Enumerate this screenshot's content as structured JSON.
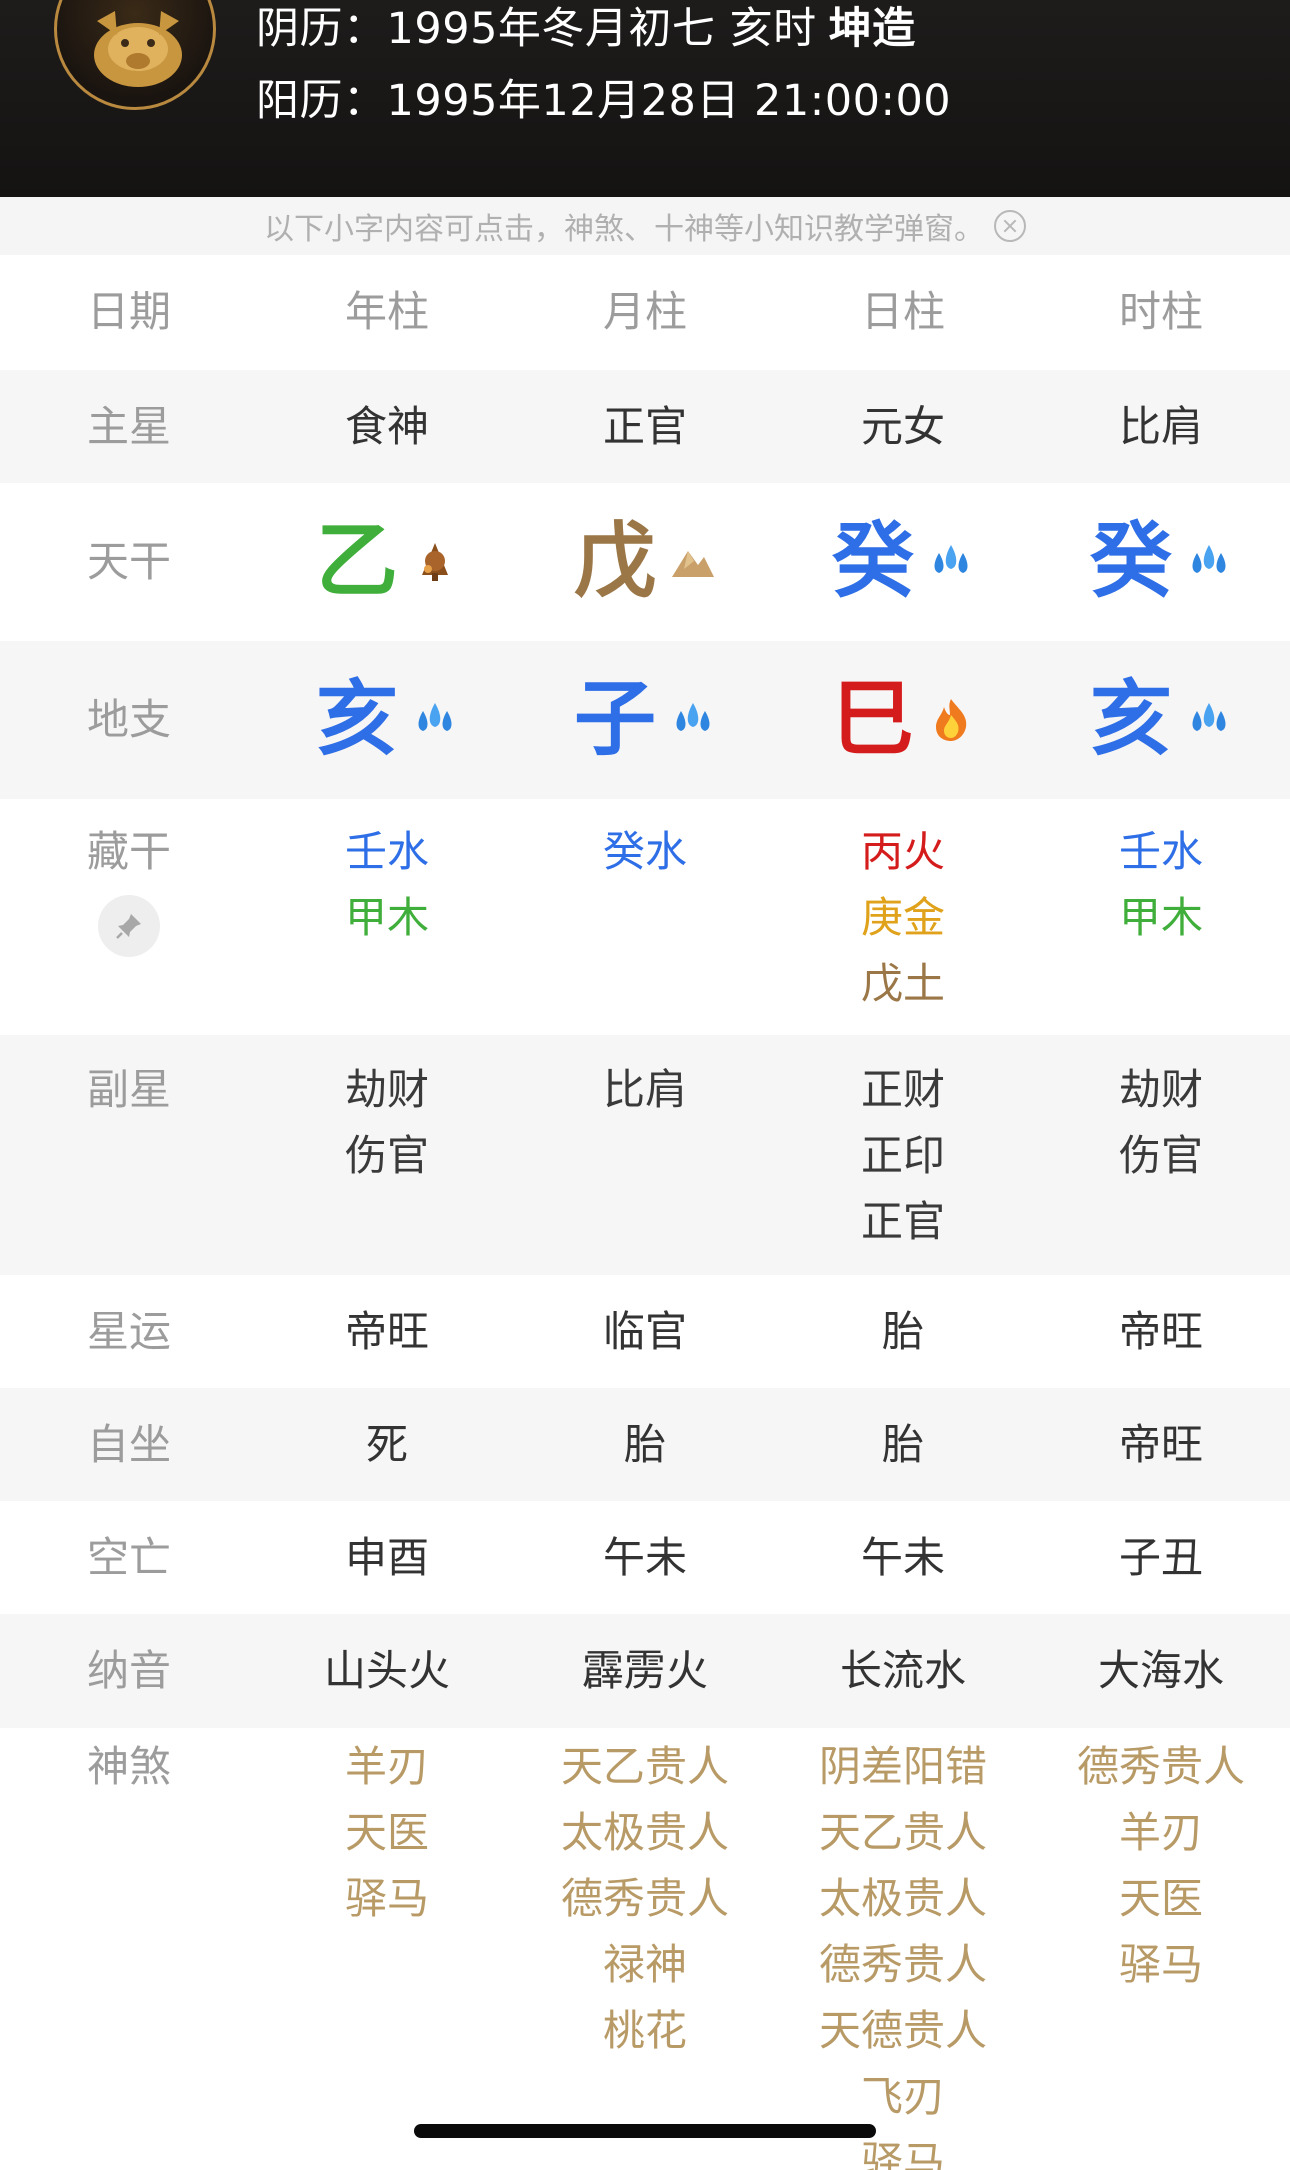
{
  "header": {
    "lunar": "阴历：1995年冬月初七 亥时",
    "gender_tag": "坤造",
    "solar": "阳历：1995年12月28日 21:00:00"
  },
  "notice": "以下小字内容可点击，神煞、十神等小知识教学弹窗。",
  "columns": [
    "日期",
    "年柱",
    "月柱",
    "日柱",
    "时柱"
  ],
  "labels": {
    "main_star": "主星",
    "heavenly_stem": "天干",
    "earthly_branch": "地支",
    "hidden_stem": "藏干",
    "sub_star": "副星",
    "star_luck": "星运",
    "self_seat": "自坐",
    "kongwang": "空亡",
    "nayin": "纳音",
    "shensha": "神煞"
  },
  "main_star": [
    "食神",
    "正官",
    "元女",
    "比肩"
  ],
  "heavenly_stem": [
    {
      "char": "乙",
      "color": "#3fae3a",
      "element_icon": "wood-element-icon"
    },
    {
      "char": "戊",
      "color": "#9b7748",
      "element_icon": "earth-element-icon"
    },
    {
      "char": "癸",
      "color": "#2e6ee6",
      "element_icon": "water-element-icon"
    },
    {
      "char": "癸",
      "color": "#2e6ee6",
      "element_icon": "water-element-icon"
    }
  ],
  "earthly_branch": [
    {
      "char": "亥",
      "color": "#2e6ee6",
      "element_icon": "water-element-icon"
    },
    {
      "char": "子",
      "color": "#2e6ee6",
      "element_icon": "water-element-icon"
    },
    {
      "char": "巳",
      "color": "#d51c1c",
      "element_icon": "fire-element-icon"
    },
    {
      "char": "亥",
      "color": "#2e6ee6",
      "element_icon": "water-element-icon"
    }
  ],
  "hidden_stem": [
    [
      {
        "text": "壬水",
        "color": "#2e6ee6"
      },
      {
        "text": "甲木",
        "color": "#3fae3a"
      }
    ],
    [
      {
        "text": "癸水",
        "color": "#2e6ee6"
      }
    ],
    [
      {
        "text": "丙火",
        "color": "#d51c1c"
      },
      {
        "text": "庚金",
        "color": "#e0a21a"
      },
      {
        "text": "戊土",
        "color": "#9b7748"
      }
    ],
    [
      {
        "text": "壬水",
        "color": "#2e6ee6"
      },
      {
        "text": "甲木",
        "color": "#3fae3a"
      }
    ]
  ],
  "sub_star": [
    [
      "劫财",
      "伤官"
    ],
    [
      "比肩"
    ],
    [
      "正财",
      "正印",
      "正官"
    ],
    [
      "劫财",
      "伤官"
    ]
  ],
  "star_luck": [
    "帝旺",
    "临官",
    "胎",
    "帝旺"
  ],
  "self_seat": [
    "死",
    "胎",
    "胎",
    "帝旺"
  ],
  "kongwang": [
    "申酉",
    "午未",
    "午未",
    "子丑"
  ],
  "nayin": [
    "山头火",
    "霹雳火",
    "长流水",
    "大海水"
  ],
  "shensha": [
    [
      "羊刃",
      "天医",
      "驿马"
    ],
    [
      "天乙贵人",
      "太极贵人",
      "德秀贵人",
      "禄神",
      "桃花"
    ],
    [
      "阴差阳错",
      "天乙贵人",
      "太极贵人",
      "德秀贵人",
      "天德贵人",
      "飞刃",
      "驿马"
    ],
    [
      "德秀贵人",
      "羊刃",
      "天医",
      "驿马"
    ]
  ]
}
